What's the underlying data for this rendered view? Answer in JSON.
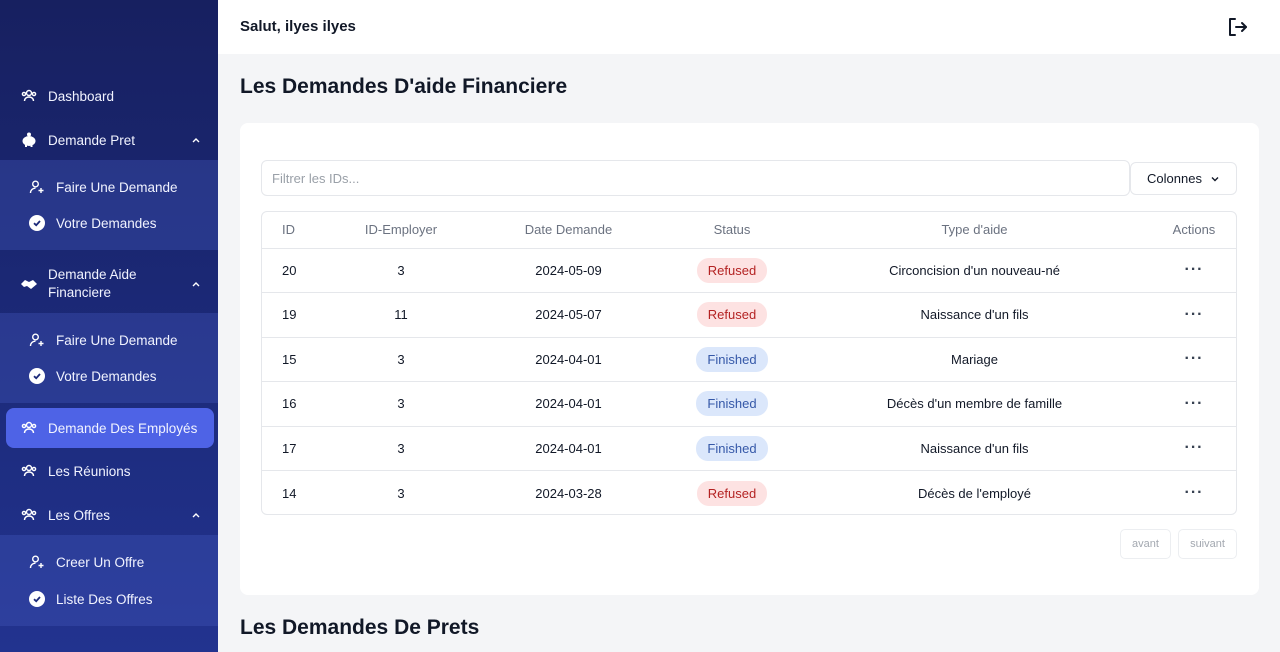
{
  "header": {
    "greeting": "Salut, ilyes ilyes"
  },
  "sidebar": {
    "dashboard": "Dashboard",
    "demande_pret": "Demande Pret",
    "pret_sub": [
      "Faire Une Demande",
      "Votre Demandes"
    ],
    "demande_aide_line1": "Demande Aide",
    "demande_aide_line2": "Financiere",
    "aide_sub": [
      "Faire Une Demande",
      "Votre Demandes"
    ],
    "demande_employes": "Demande Des Employés",
    "reunions": "Les Réunions",
    "offres": "Les Offres",
    "offres_sub": [
      "Creer Un Offre",
      "Liste Des Offres"
    ]
  },
  "main": {
    "title": "Les Demandes D'aide Financiere",
    "filter_placeholder": "Filtrer les IDs...",
    "columns_button": "Colonnes",
    "table": {
      "headers": [
        "ID",
        "ID-Employer",
        "Date Demande",
        "Status",
        "Type d'aide",
        "Actions"
      ],
      "rows": [
        {
          "id": "20",
          "employer": "3",
          "date": "2024-05-09",
          "status": "Refused",
          "type": "Circoncision d'un nouveau-né"
        },
        {
          "id": "19",
          "employer": "11",
          "date": "2024-05-07",
          "status": "Refused",
          "type": "Naissance d'un fils"
        },
        {
          "id": "15",
          "employer": "3",
          "date": "2024-04-01",
          "status": "Finished",
          "type": "Mariage"
        },
        {
          "id": "16",
          "employer": "3",
          "date": "2024-04-01",
          "status": "Finished",
          "type": "Décès d'un membre de famille"
        },
        {
          "id": "17",
          "employer": "3",
          "date": "2024-04-01",
          "status": "Finished",
          "type": "Naissance d'un fils"
        },
        {
          "id": "14",
          "employer": "3",
          "date": "2024-03-28",
          "status": "Refused",
          "type": "Décès de l'employé"
        }
      ]
    },
    "pager": {
      "prev": "avant",
      "next": "suivant"
    },
    "section2_title": "Les Demandes De Prets"
  },
  "colors": {
    "sidebar": "#1c2a7a",
    "active": "#4e63e6",
    "refused_bg": "#fde2e2",
    "finished_bg": "#dbe7fb"
  }
}
